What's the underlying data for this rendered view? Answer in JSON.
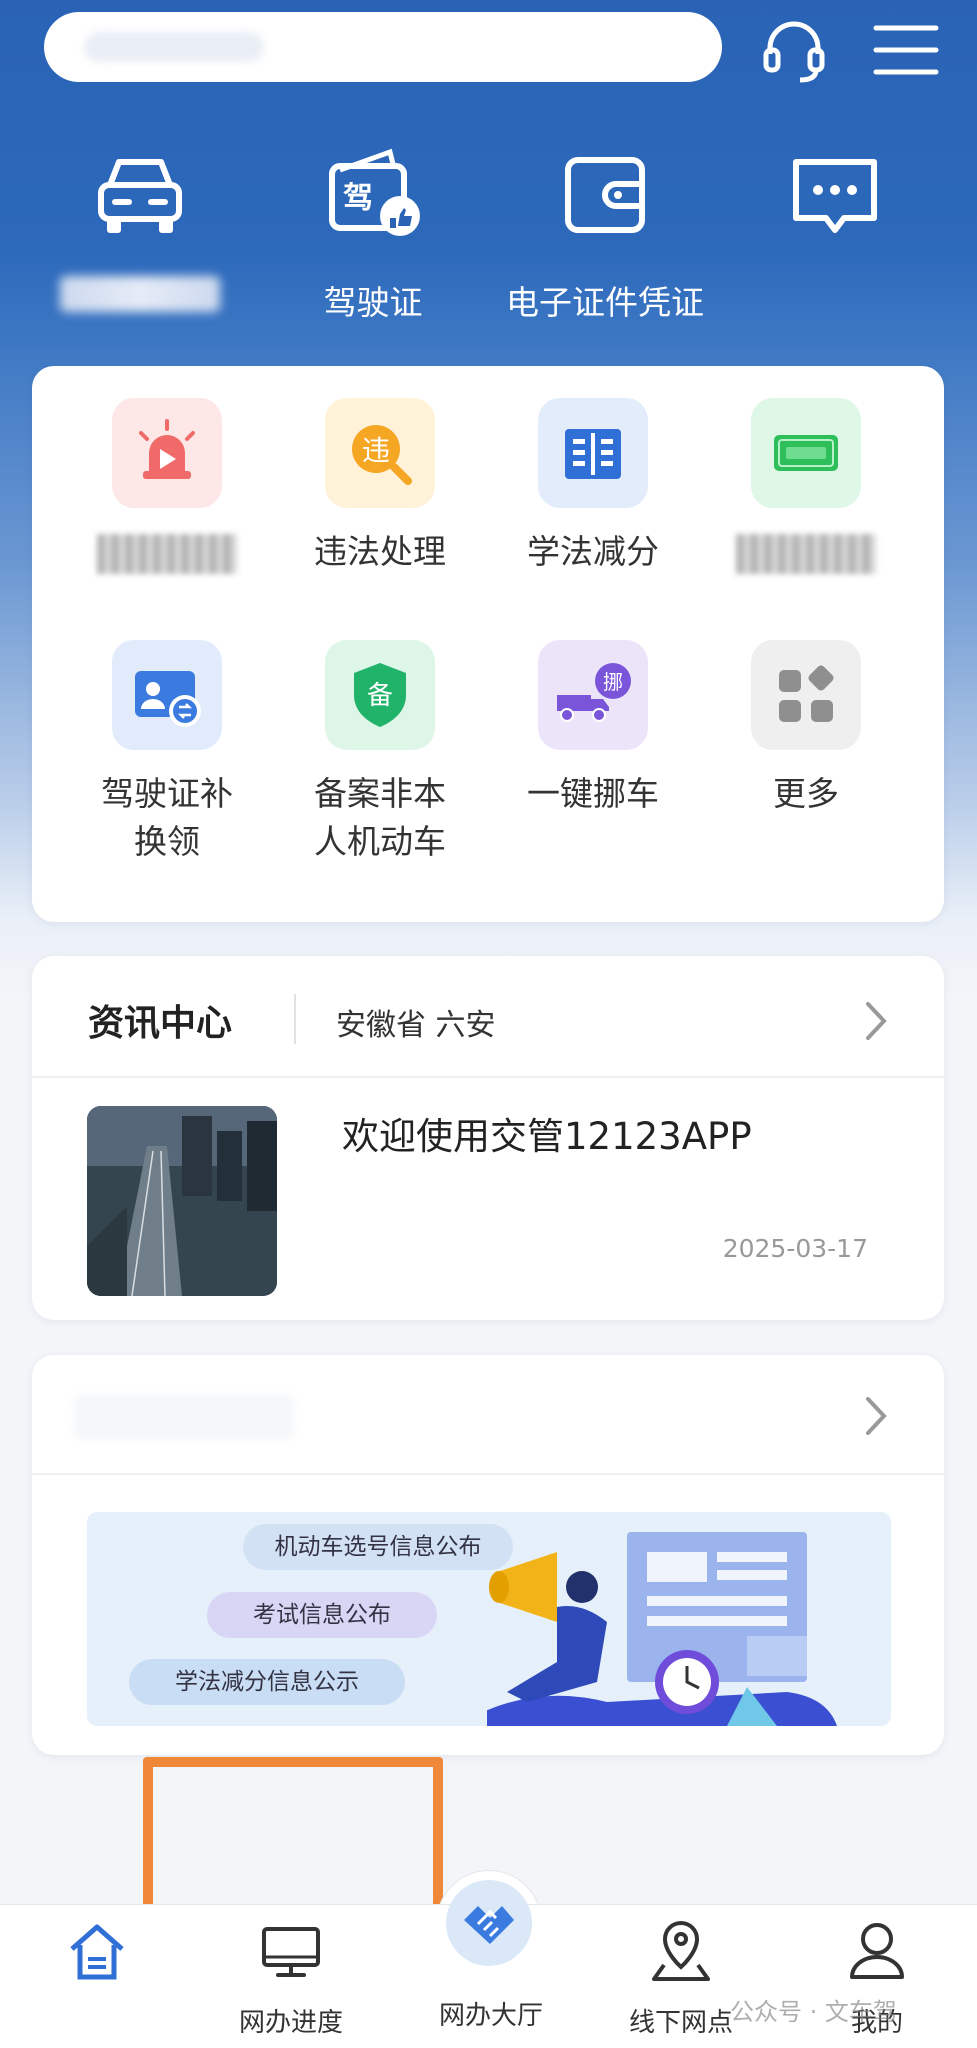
{
  "header": {
    "search": {
      "placeholder": ""
    },
    "support_icon": "headset-icon",
    "menu_icon": "menu-icon"
  },
  "quick_actions": [
    {
      "id": "car",
      "icon": "car-icon",
      "label": ""
    },
    {
      "id": "license",
      "icon": "driver-license-icon",
      "label": "驾驶证",
      "icon_text": "驾"
    },
    {
      "id": "e-cert",
      "icon": "wallet-icon",
      "label": "电子证件凭证"
    },
    {
      "id": "message",
      "icon": "chat-icon",
      "label": ""
    }
  ],
  "services": [
    {
      "id": "alert",
      "icon": "alarm-light-icon",
      "label": ""
    },
    {
      "id": "violation",
      "icon": "violation-search-icon",
      "label": "违法处理",
      "icon_text": "违"
    },
    {
      "id": "study",
      "icon": "book-icon",
      "label": "学法减分"
    },
    {
      "id": "plate",
      "icon": "license-plate-icon",
      "label": ""
    },
    {
      "id": "license-renew",
      "icon": "id-card-exchange-icon",
      "label_line1": "驾驶证补",
      "label_line2": "换领"
    },
    {
      "id": "record-vehicle",
      "icon": "shield-icon",
      "label_line1": "备案非本",
      "label_line2": "人机动车",
      "icon_text": "备"
    },
    {
      "id": "move-car",
      "icon": "truck-icon",
      "label": "一键挪车",
      "icon_text": "挪"
    },
    {
      "id": "more",
      "icon": "grid-more-icon",
      "label": "更多"
    }
  ],
  "news": {
    "title": "资讯中心",
    "location": "安徽省 六安",
    "item": {
      "headline": "欢迎使用交管12123APP",
      "date": "2025-03-17"
    }
  },
  "info_banner": {
    "title": "",
    "pills": [
      "机动车选号信息公布",
      "考试信息公布",
      "学法减分信息公示"
    ]
  },
  "tabbar": [
    {
      "id": "home",
      "icon": "home-icon",
      "label": ""
    },
    {
      "id": "progress",
      "icon": "monitor-icon",
      "label": "网办进度"
    },
    {
      "id": "hall",
      "icon": "handshake-icon",
      "label": "网办大厅"
    },
    {
      "id": "offline",
      "icon": "map-pin-icon",
      "label": "线下网点"
    },
    {
      "id": "mine",
      "icon": "user-icon",
      "label": "我的"
    }
  ],
  "watermark": "公众号 · 文车驾",
  "colors": {
    "brand_blue": "#2a63b6",
    "highlight_orange": "#f0883a"
  }
}
